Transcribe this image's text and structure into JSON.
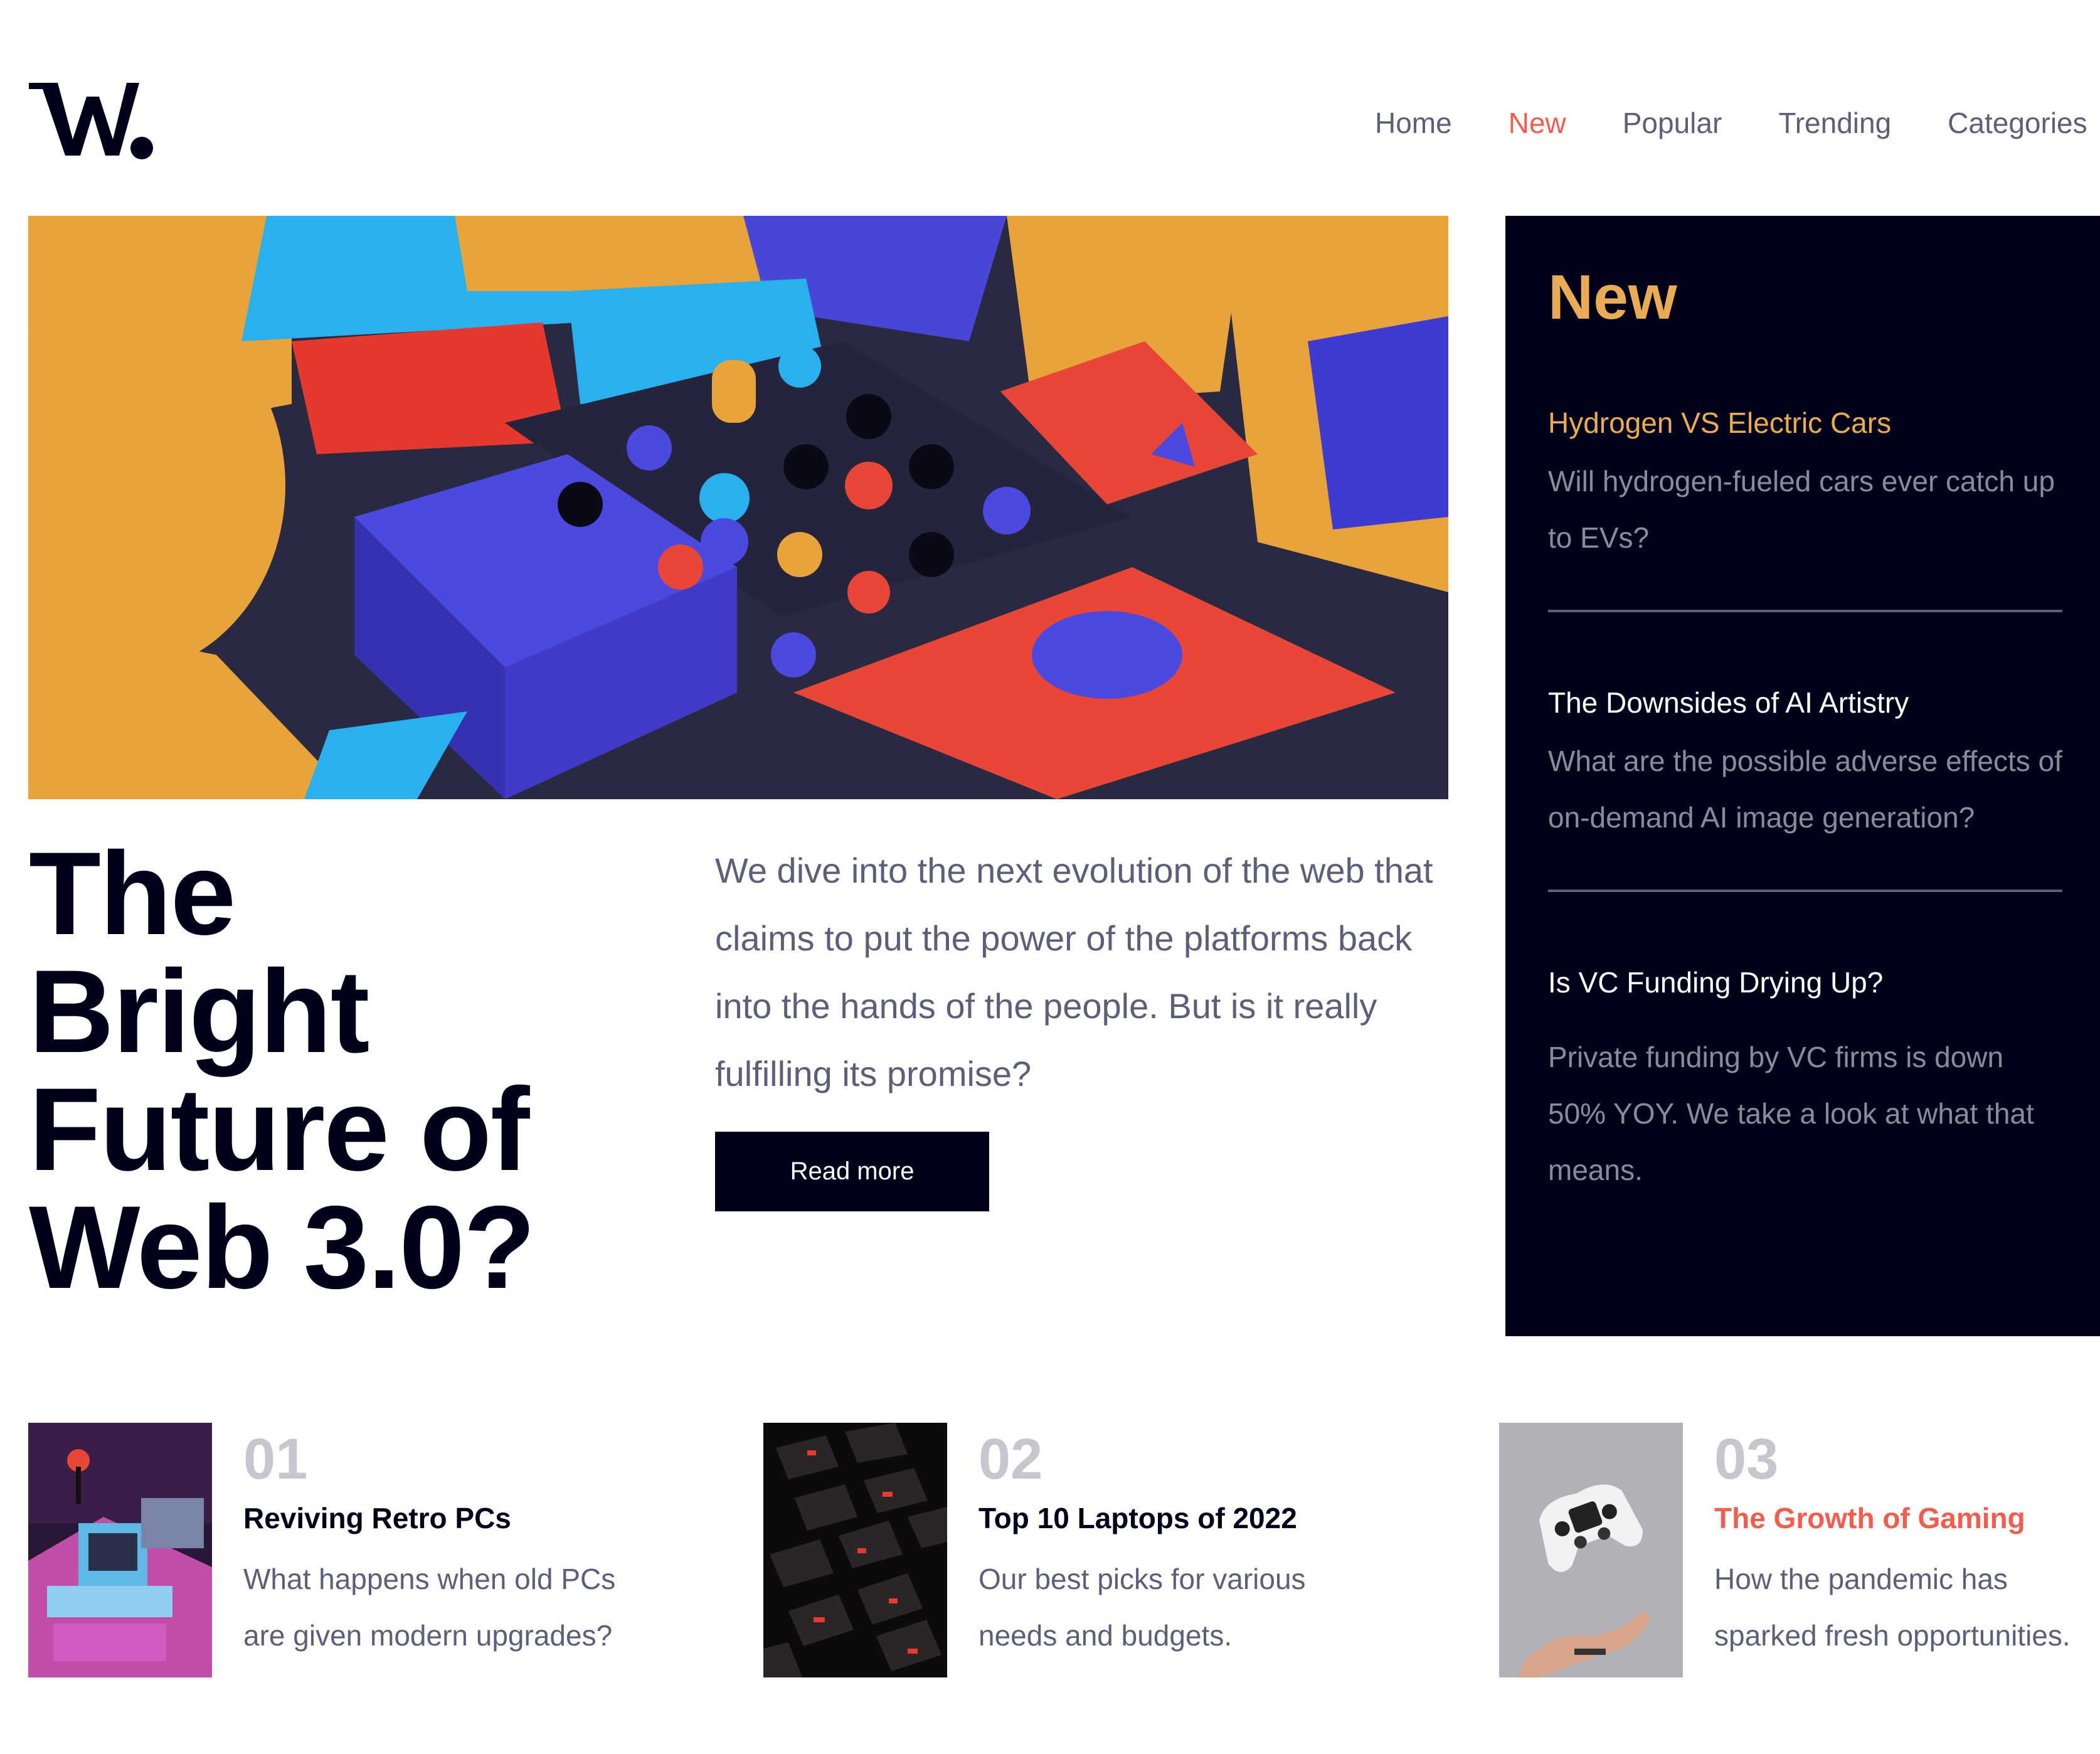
{
  "header": {
    "logo_icon": "w-wordmark-logo",
    "nav": [
      {
        "label": "Home",
        "active": false
      },
      {
        "label": "New",
        "active": true
      },
      {
        "label": "Popular",
        "active": false
      },
      {
        "label": "Trending",
        "active": false
      },
      {
        "label": "Categories",
        "active": false
      }
    ]
  },
  "hero": {
    "image_icon": "abstract-3d-blocks-illustration",
    "title_lines": [
      "The",
      "Bright",
      "Future of",
      "Web 3.0?"
    ],
    "description": "We dive into the next evolution of the web that claims to put the power of the platforms back into the hands of the people. But is it really fulfilling its promise?",
    "button_label": "Read more"
  },
  "sidebar": {
    "heading": "New",
    "items": [
      {
        "title": "Hydrogen VS Electric Cars",
        "description": "Will hydrogen-fueled cars ever catch up to EVs?"
      },
      {
        "title": "The Downsides of AI Artistry",
        "description": "What are the possible adverse effects of on-demand AI image generation?"
      },
      {
        "title": "Is VC Funding Drying Up?",
        "description": "Private funding by VC firms is down 50% YOY. We take a look at what that means."
      }
    ]
  },
  "cards": [
    {
      "number": "01",
      "title": "Reviving Retro PCs",
      "desc_lines": [
        "What happens when old PCs",
        "are given modern upgrades?"
      ],
      "image_icon": "retro-pc-image"
    },
    {
      "number": "02",
      "title": "Top 10 Laptops of 2022",
      "desc_lines": [
        "Our best picks for various",
        "needs and budgets."
      ],
      "image_icon": "laptop-keyboard-image"
    },
    {
      "number": "03",
      "title": "The Growth of Gaming",
      "desc_lines": [
        "How the pandemic has",
        "sparked fresh opportunities."
      ],
      "image_icon": "game-controller-image"
    }
  ],
  "colors": {
    "dark_navy": "#00001a",
    "accent_red": "#f15e50",
    "accent_orange": "#e9ab53",
    "grayish_blue": "#5d5f79",
    "light_gray": "#c5c6ce"
  }
}
